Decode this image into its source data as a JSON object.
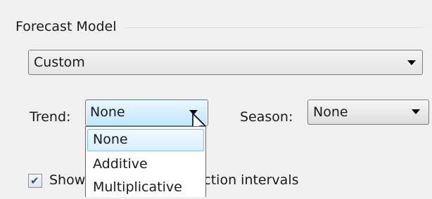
{
  "forecast_model": {
    "group_title": "Forecast Model",
    "model_select": {
      "value": "Custom"
    }
  },
  "trend": {
    "label": "Trend:",
    "selected": "None",
    "options": [
      "None",
      "Additive",
      "Multiplicative"
    ]
  },
  "season": {
    "label": "Season:",
    "selected": "None"
  },
  "prediction_intervals": {
    "checked": true,
    "label_visible_start": "Show",
    "label_visible_end": "iction intervals"
  },
  "colors": {
    "window_bg": "#f0f0f0",
    "focus_border": "#3c7fb1",
    "selection_fill": "#d6edfc",
    "selection_border": "#7fbbe6"
  },
  "icons": {
    "dropdown_arrow": "chevron-down-icon",
    "cursor": "mouse-pointer-icon",
    "checkmark": "checkmark-icon"
  }
}
